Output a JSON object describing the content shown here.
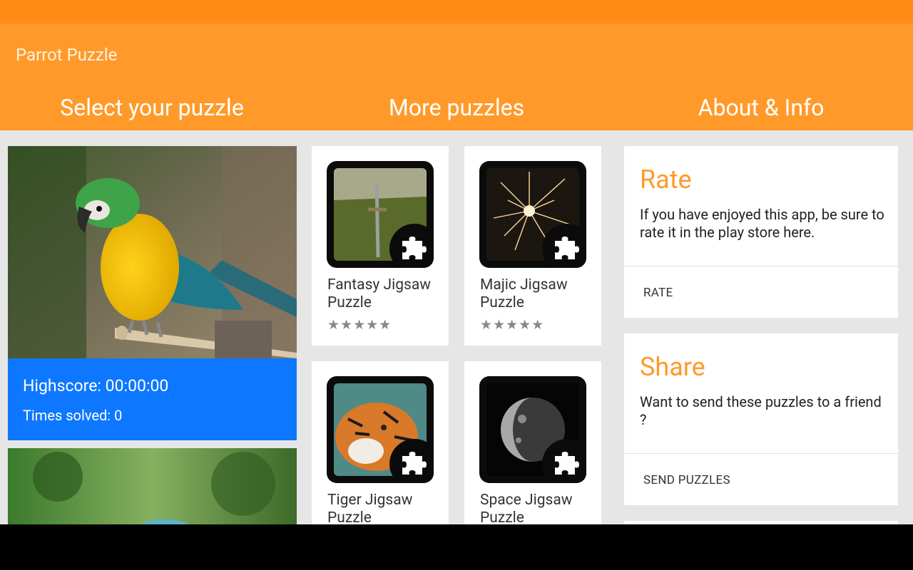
{
  "app": {
    "title": "Parrot Puzzle"
  },
  "colors": {
    "statusbar": "#ff8a14",
    "appbar": "#ff9a2a",
    "accent": "#ff9a2a",
    "info_blue": "#0d78ff"
  },
  "sections": [
    "Select your puzzle",
    "More puzzles",
    "About & Info"
  ],
  "puzzles": [
    {
      "highscore": "Highscore: 00:00:00",
      "times_solved": "Times solved: 0"
    }
  ],
  "more_puzzles": [
    {
      "name": "Fantasy Jigsaw Puzzle",
      "stars": "★★★★★",
      "icon": "puzzle-piece-icon"
    },
    {
      "name": "Majic Jigsaw Puzzle",
      "stars": "★★★★★",
      "icon": "puzzle-piece-icon"
    },
    {
      "name": "Tiger Jigsaw Puzzle",
      "stars": "★★★★★",
      "icon": "puzzle-piece-icon"
    },
    {
      "name": "Space Jigsaw Puzzle",
      "stars": "★★★★★",
      "icon": "puzzle-piece-icon"
    }
  ],
  "about": {
    "rate": {
      "title": "Rate",
      "text": "If you have enjoyed this app, be sure to rate it in the play store here.",
      "action": "RATE"
    },
    "share": {
      "title": "Share",
      "text": "Want to send these puzzles to a friend ?",
      "action": "SEND PUZZLES"
    }
  }
}
